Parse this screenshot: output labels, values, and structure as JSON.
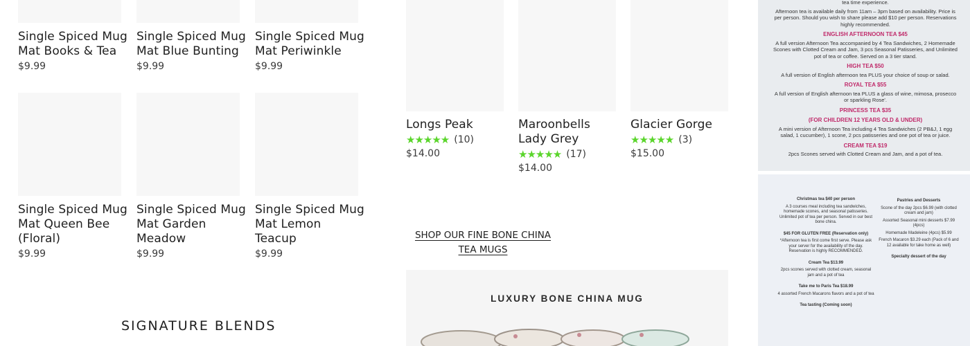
{
  "mug_mats": [
    {
      "title": "Single Spiced Mug Mat Books & Tea",
      "price": "$9.99"
    },
    {
      "title": "Single Spiced Mug Mat Blue Bunting",
      "price": "$9.99"
    },
    {
      "title": "Single Spiced Mug Mat Periwinkle",
      "price": "$9.99"
    },
    {
      "title": "Single Spiced Mug Mat Queen Bee (Floral)",
      "price": "$9.99"
    },
    {
      "title": "Single Spiced Mug Mat Garden Meadow",
      "price": "$9.99"
    },
    {
      "title": "Single Spiced Mug Mat Lemon Teacup",
      "price": "$9.99"
    }
  ],
  "signature": {
    "heading": "SIGNATURE BLENDS"
  },
  "teas": [
    {
      "title": "Longs Peak",
      "count": "(10)",
      "price": "$14.00",
      "rating": 5
    },
    {
      "title": "Maroonbells Lady Grey",
      "count": "(17)",
      "price": "$14.00",
      "rating": 5
    },
    {
      "title": "Glacier Gorge",
      "count": "(3)",
      "price": "$15.00",
      "rating": 5
    }
  ],
  "shop_link": "SHOP OUR FINE BONE CHINA TEA MUGS",
  "promo": {
    "caption": "LUXURY BONE CHINA MUG"
  },
  "menu1": {
    "lines": [
      {
        "t": "tea time experience.",
        "head": false
      },
      {
        "t": "Afternoon tea is available daily from 11am – 3pm based on availability. Price is per person. Should you wish to share please add $10 per person. Reservations highly recommended.",
        "head": false
      },
      {
        "t": "ENGLISH AFTERNOON TEA $45",
        "head": true
      },
      {
        "t": "A full version Afternoon Tea accompanied by 4 Tea Sandwiches, 2 Homemade Scones with Clotted Cream and Jam, 3 pcs Seasonal Patisseries, and Unlimited pot of tea or coffee. Served on a 3 tier stand.",
        "head": false
      },
      {
        "t": "HIGH TEA $50",
        "head": true
      },
      {
        "t": "A full version of English afternoon tea PLUS your choice of soup or salad.",
        "head": false
      },
      {
        "t": "ROYAL TEA $55",
        "head": true
      },
      {
        "t": "A full version of English afternoon tea PLUS a glass of wine, mimosa, prosecco or sparkling Rose'.",
        "head": false
      },
      {
        "t": "PRINCESS TEA $35",
        "head": true
      },
      {
        "t": "(FOR CHILDREN 12 YEARS OLD & UNDER)",
        "head": true
      },
      {
        "t": "A mini version of Afternoon Tea including 4 Tea Sandwiches (2 PB&J, 1 egg salad, 1 cucumber), 1 scone, 2 pcs patisseries and one pot of tea or juice.",
        "head": false
      },
      {
        "t": "CREAM TEA $19",
        "head": true
      },
      {
        "t": "2pcs Scones served with Clotted Cream and Jam, and a pot of tea.",
        "head": false
      }
    ]
  },
  "menu2": {
    "left": [
      {
        "t": "Christmas tea $40 per person",
        "head": true
      },
      {
        "t": "A 3 courses meal including tea sandwiches, homemade scones, and seasonal patisseries. Unlimited pot of tea per person. Served in our best bone china.",
        "head": false
      },
      {
        "t": "$45 FOR GLUTEN FREE (Reservation only)",
        "head": true
      },
      {
        "t": "*Afternoon tea is first come first serve. Please ask your server for the availability of the day. Reservation is highly RECOMMENDED.",
        "head": false
      },
      {
        "t": "Cream Tea $13.99",
        "head": true
      },
      {
        "t": "2pcs scones served with clotted cream, seasonal jam and a pot of tea",
        "head": false
      },
      {
        "t": "Take me to Paris Tea $18.99",
        "head": true
      },
      {
        "t": "4 assorted French Macarons flavors and a pot of tea",
        "head": false
      },
      {
        "t": "Tea tasting (Coming soon)",
        "head": true
      }
    ],
    "right": [
      {
        "t": "Pastries and Desserts",
        "head": true
      },
      {
        "t": "Scone of the day 2pcs $6.99 (with clotted cream and jam)",
        "head": false
      },
      {
        "t": "Assorted Seasonal mini desserts $7.99 (4pcs)",
        "head": false
      },
      {
        "t": "Homemade Madeleine (4pcs) $5.99",
        "head": false
      },
      {
        "t": "French Macaron $3.29 each (Pack of 6 and 12 available for take home as well)",
        "head": false
      },
      {
        "t": "Specialty dessert of the day",
        "head": true
      }
    ]
  }
}
